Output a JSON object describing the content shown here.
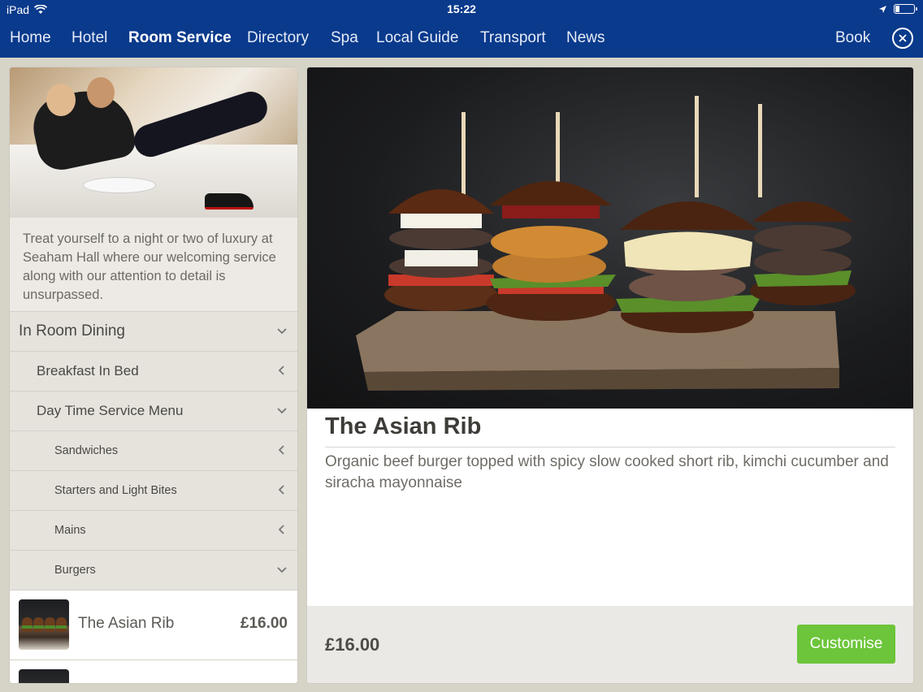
{
  "status_bar": {
    "device": "iPad",
    "time": "15:22"
  },
  "nav": {
    "items": [
      {
        "label": "Home"
      },
      {
        "label": "Hotel"
      },
      {
        "label": "Room Service"
      },
      {
        "label": "Directory"
      },
      {
        "label": "Spa"
      },
      {
        "label": "Local Guide"
      },
      {
        "label": "Transport"
      },
      {
        "label": "News"
      }
    ],
    "active": "Room Service",
    "book_label": "Book",
    "close_icon": "close-icon"
  },
  "sidebar": {
    "intro": "Treat yourself to a night or two of luxury at Seaham Hall where our welcoming service along with our attention to detail is unsurpassed.",
    "menu": [
      {
        "label": "In Room Dining",
        "level": 1,
        "state": "expanded"
      },
      {
        "label": "Breakfast In Bed",
        "level": 2,
        "state": "collapsed"
      },
      {
        "label": "Day Time Service Menu",
        "level": 2,
        "state": "expanded"
      },
      {
        "label": "Sandwiches",
        "level": 3,
        "state": "collapsed"
      },
      {
        "label": "Starters and Light Bites",
        "level": 3,
        "state": "collapsed"
      },
      {
        "label": "Mains",
        "level": 3,
        "state": "collapsed"
      },
      {
        "label": "Burgers",
        "level": 3,
        "state": "expanded"
      }
    ],
    "items": [
      {
        "name": "The Asian Rib",
        "price": "£16.00"
      }
    ]
  },
  "detail": {
    "title": "The Asian Rib",
    "description": "Organic beef burger topped with spicy slow cooked short rib, kimchi cucumber and siracha mayonnaise",
    "price": "£16.00",
    "customise_label": "Customise"
  },
  "colors": {
    "nav_bg": "#0a3a8c",
    "accent_green": "#6cc53a"
  }
}
